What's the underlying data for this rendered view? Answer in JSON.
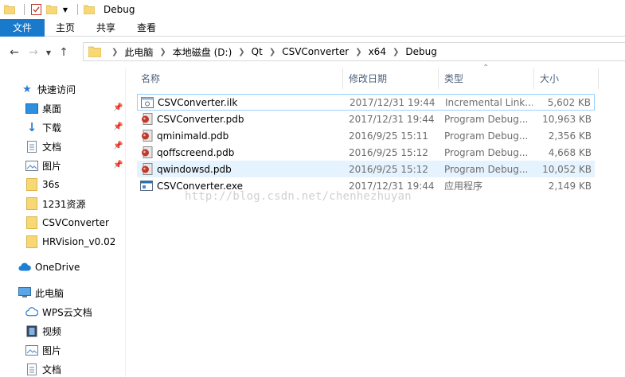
{
  "window": {
    "title": "Debug"
  },
  "ribbon": {
    "tabs": [
      "文件",
      "主页",
      "共享",
      "查看"
    ]
  },
  "address": {
    "crumbs": [
      "此电脑",
      "本地磁盘 (D:)",
      "Qt",
      "CSVConverter",
      "x64",
      "Debug"
    ]
  },
  "nav": {
    "quick_access": "快速访问",
    "items": [
      {
        "label": "桌面",
        "pinned": true
      },
      {
        "label": "下载",
        "pinned": true
      },
      {
        "label": "文档",
        "pinned": true
      },
      {
        "label": "图片",
        "pinned": true
      },
      {
        "label": "36s"
      },
      {
        "label": "1231资源"
      },
      {
        "label": "CSVConverter"
      },
      {
        "label": "HRVision_v0.02"
      }
    ],
    "onedrive": "OneDrive",
    "this_pc": "此电脑",
    "pc_items": [
      "WPS云文档",
      "视频",
      "图片",
      "文档"
    ]
  },
  "columns": {
    "name": "名称",
    "date": "修改日期",
    "type": "类型",
    "size": "大小"
  },
  "files": [
    {
      "name": "CSVConverter.ilk",
      "date": "2017/12/31 19:44",
      "type": "Incremental Link...",
      "size": "5,602 KB",
      "icon": "ilk-file-icon"
    },
    {
      "name": "CSVConverter.pdb",
      "date": "2017/12/31 19:44",
      "type": "Program Debug...",
      "size": "10,963 KB",
      "icon": "pdb-file-icon"
    },
    {
      "name": "qminimald.pdb",
      "date": "2016/9/25 15:11",
      "type": "Program Debug...",
      "size": "2,356 KB",
      "icon": "pdb-file-icon"
    },
    {
      "name": "qoffscreend.pdb",
      "date": "2016/9/25 15:12",
      "type": "Program Debug...",
      "size": "4,668 KB",
      "icon": "pdb-file-icon"
    },
    {
      "name": "qwindowsd.pdb",
      "date": "2016/9/25 15:12",
      "type": "Program Debug...",
      "size": "10,052 KB",
      "icon": "pdb-file-icon"
    },
    {
      "name": "CSVConverter.exe",
      "date": "2017/12/31 19:44",
      "type": "应用程序",
      "size": "2,149 KB",
      "icon": "exe-file-icon"
    }
  ],
  "watermark": "http://blog.csdn.net/chenhezhuyan",
  "colors": {
    "accent": "#1979ca",
    "folder": "#f8d775",
    "selection": "#e5f3ff"
  }
}
